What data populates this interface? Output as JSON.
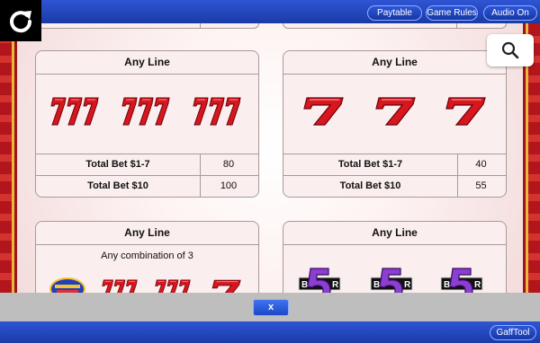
{
  "toolbar": {
    "paytable_label": "Paytable",
    "rules_label": "Game Rules",
    "audio_label": "Audio On"
  },
  "cards": [
    {
      "title": "Any Line",
      "symbols": [
        "triple-seven-icon",
        "triple-seven-icon",
        "triple-seven-icon"
      ],
      "rows": [
        {
          "label": "Total Bet $1-7",
          "value": "80"
        },
        {
          "label": "Total Bet $10",
          "value": "100"
        }
      ]
    },
    {
      "title": "Any Line",
      "symbols": [
        "single-seven-icon",
        "single-seven-icon",
        "single-seven-icon"
      ],
      "rows": [
        {
          "label": "Total Bet $1-7",
          "value": "40"
        },
        {
          "label": "Total Bet $10",
          "value": "55"
        }
      ]
    },
    {
      "title": "Any Line",
      "subtitle": "Any combination of 3",
      "symbols": [
        "wheel-of-fortune-logo-icon",
        "triple-seven-icon",
        "triple-seven-icon",
        "single-seven-icon"
      ]
    },
    {
      "title": "Any Line",
      "symbols": [
        "bar-five-icon",
        "bar-five-icon",
        "bar-five-icon"
      ]
    }
  ],
  "footer": {
    "close_label": "x",
    "gafftool_label": "GaffTool"
  },
  "colors": {
    "accent_blue": "#1b3aa8",
    "seven_red": "#d7161e",
    "five_purple": "#8a3fd0",
    "border_gold": "#e8b93a"
  }
}
